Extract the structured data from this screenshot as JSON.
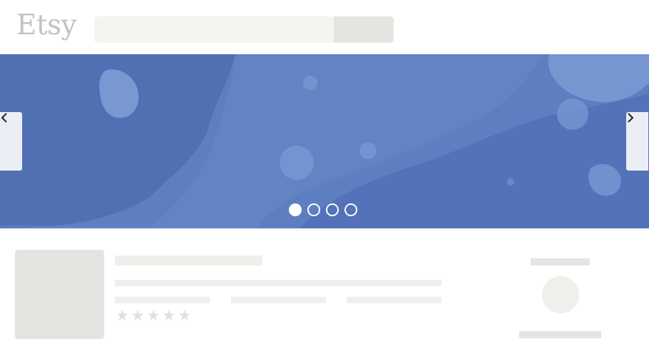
{
  "header": {
    "logo_text": "Etsy",
    "search_placeholder": "",
    "search_button_label": ""
  },
  "hero": {
    "prev_label": "‹",
    "next_label": "›",
    "slide_count": 4,
    "active_slide": 1,
    "background_color": "#5879bc"
  },
  "listing": {
    "rating_stars": [
      "★",
      "★",
      "★",
      "★",
      "★"
    ]
  },
  "colors": {
    "skeleton": "#efefec",
    "hero_blue": "#5879bc"
  }
}
